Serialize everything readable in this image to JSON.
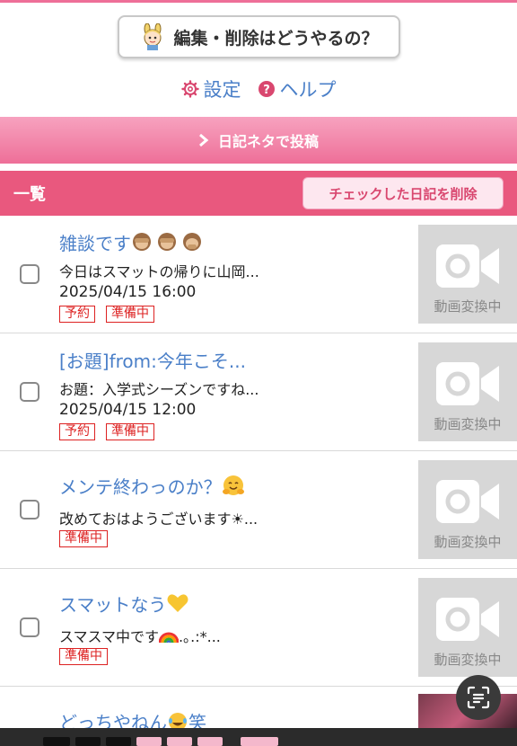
{
  "top": {
    "help_button_label": "編集・削除はどうやるの？",
    "settings_label": "設定",
    "help_label": "ヘルプ"
  },
  "post_bar": {
    "label": "日記ネタで投稿"
  },
  "list_header": {
    "title": "一覧",
    "delete_checked_label": "チェックした日記を削除"
  },
  "thumb_caption": "動画変換中",
  "entries": [
    {
      "title": "雑談です",
      "excerpt": "今日はスマットの帰りに山岡...",
      "datetime": "2025/04/15 16:00",
      "badge1": "予約",
      "badge2": "準備中"
    },
    {
      "title": "[お題]from:今年こそ...",
      "excerpt": "お題：入学式シーズンですね...",
      "datetime": "2025/04/15 12:00",
      "badge1": "予約",
      "badge2": "準備中"
    },
    {
      "title": "メンテ終わっのか？",
      "excerpt": "改めておはようございます☀...",
      "badge2": "準備中"
    },
    {
      "title": "スマットなう",
      "excerpt": "スマスマ中です",
      "excerpt_tail": ".｡.:*...",
      "badge2": "準備中"
    },
    {
      "title": "どっちやねん",
      "title_tail": "笑"
    }
  ],
  "colors": {
    "accent_pink": "#e9587e",
    "link_blue": "#4a7fc8",
    "badge_red": "#dd2222"
  }
}
